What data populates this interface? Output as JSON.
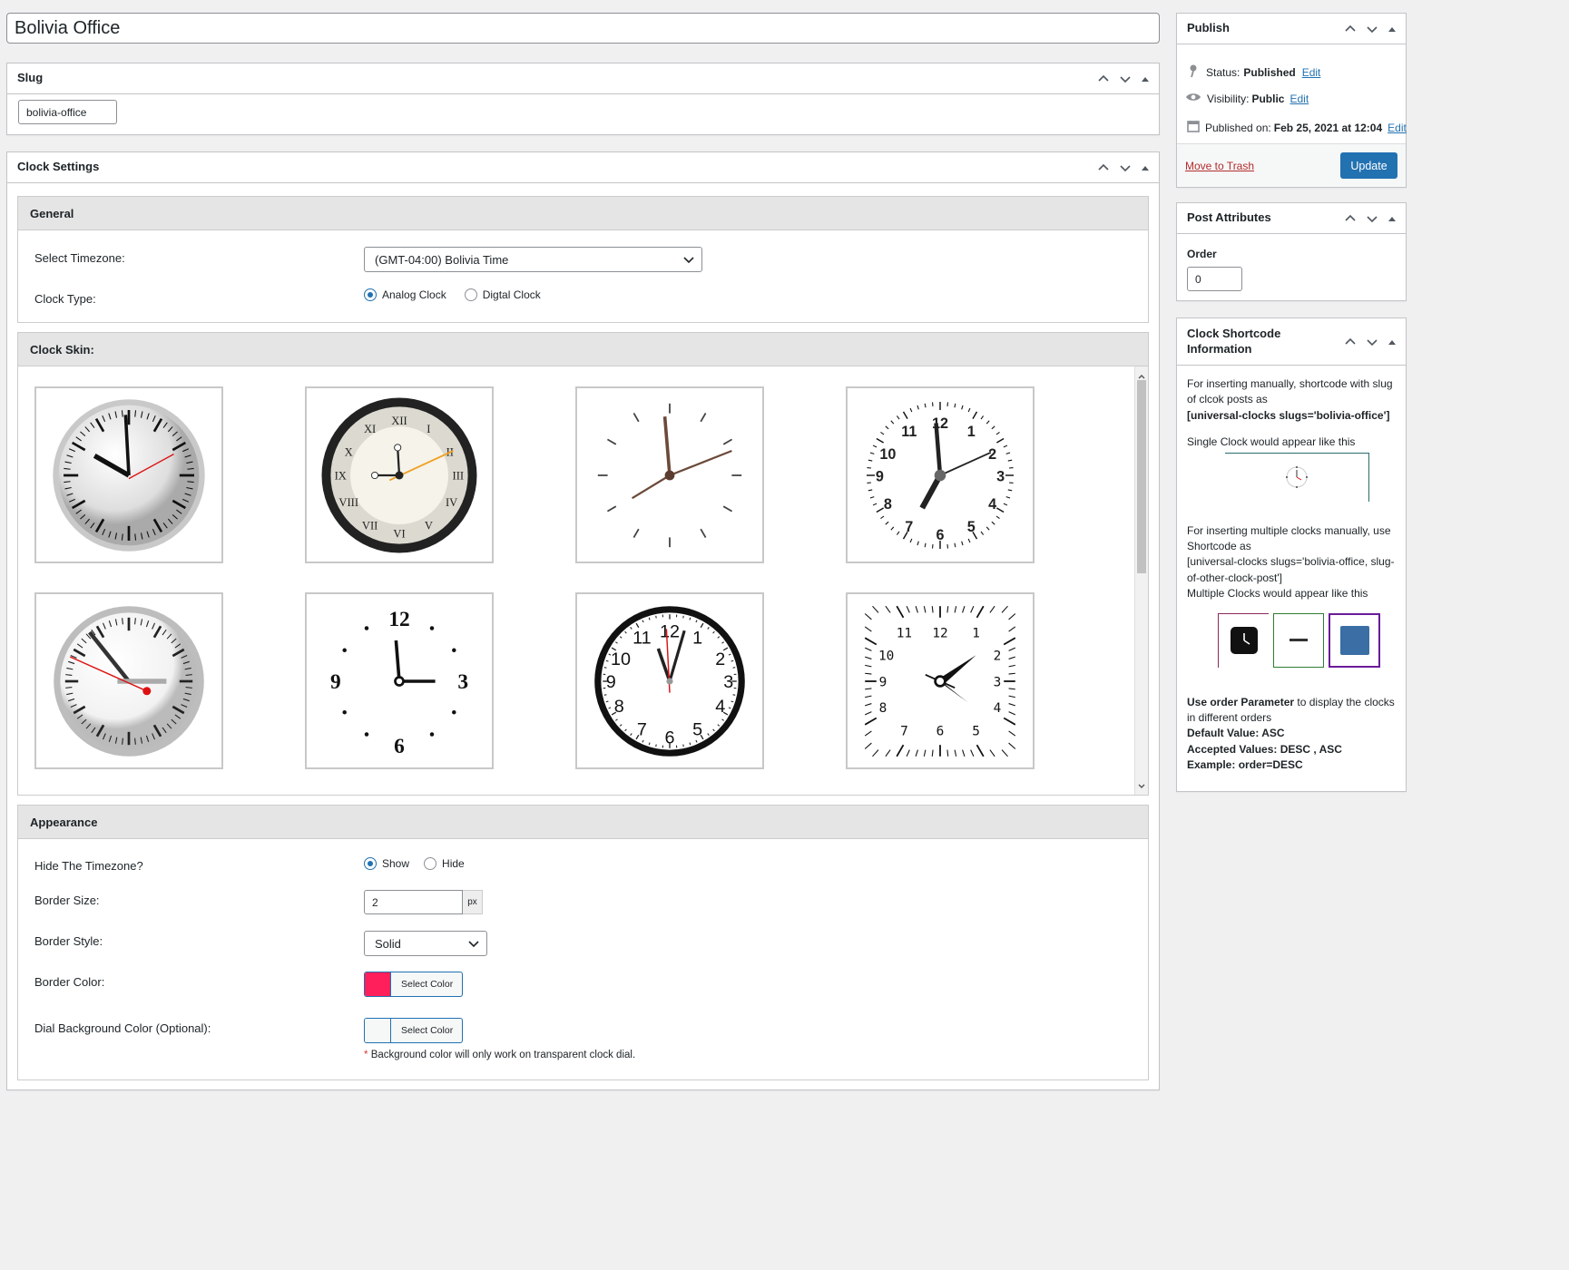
{
  "post_title": "Bolivia Office",
  "slug_box": {
    "title": "Slug",
    "value": "bolivia-office"
  },
  "clock_settings": {
    "title": "Clock Settings",
    "general": {
      "heading": "General",
      "timezone_label": "Select Timezone:",
      "timezone_value": "(GMT-04:00) Bolivia Time",
      "clock_type_label": "Clock Type:",
      "clock_type_options": [
        "Analog Clock",
        "Digtal Clock"
      ],
      "clock_type_selected": "Analog Clock"
    },
    "skin": {
      "heading": "Clock Skin:"
    },
    "appearance": {
      "heading": "Appearance",
      "hide_tz_label": "Hide The Timezone?",
      "hide_tz_options": [
        "Show",
        "Hide"
      ],
      "hide_tz_selected": "Show",
      "border_size_label": "Border Size:",
      "border_size_value": "2",
      "border_size_unit": "px",
      "border_style_label": "Border Style:",
      "border_style_value": "Solid",
      "border_color_label": "Border Color:",
      "border_color_value": "#ff1f5a",
      "select_color_label": "Select Color",
      "dial_bg_label": "Dial Background Color (Optional):",
      "dial_bg_value": "#f6f7f7",
      "note_star": "*",
      "note_text": "Background color will only work on transparent clock dial."
    }
  },
  "publish": {
    "title": "Publish",
    "status_label": "Status:",
    "status_value": "Published",
    "visibility_label": "Visibility:",
    "visibility_value": "Public",
    "published_label": "Published on:",
    "published_value": "Feb 25, 2021 at 12:04",
    "edit": "Edit",
    "trash": "Move to Trash",
    "update": "Update"
  },
  "attributes": {
    "title": "Post Attributes",
    "order_label": "Order",
    "order_value": "0"
  },
  "shortcode": {
    "title_line1": "Clock Shortcode",
    "title_line2": "Information",
    "p1": "For inserting manually, shortcode with slug of clcok posts as",
    "p1_code": "[universal-clocks slugs='bolivia-office']",
    "p2": "Single Clock would appear like this",
    "p3": "For inserting multiple clocks manually, use Shortcode as",
    "p3_code": "[universal-clocks slugs='bolivia-office, slug-of-other-clock-post']",
    "p4": "Multiple Clocks would appear like this",
    "p5_a": "Use order Parameter",
    "p5_b": " to display the clocks in different orders",
    "default": "Default Value: ASC",
    "accepted": "Accepted Values: DESC , ASC",
    "example": "Example: order=DESC"
  },
  "colors": {
    "accent": "#2271b1",
    "trash": "#b32d2e",
    "panel_bg": "#ffffff",
    "page_bg": "#f0f0f1"
  }
}
